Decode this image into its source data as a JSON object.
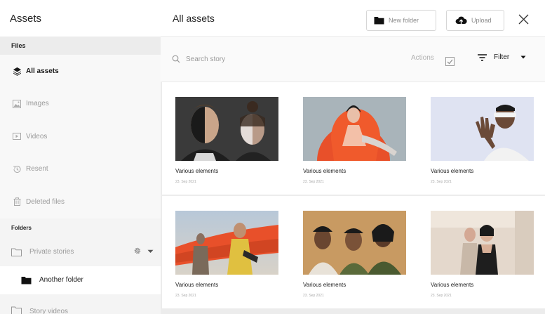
{
  "sidebar": {
    "title": "Assets",
    "files_section": "Files",
    "items": [
      {
        "label": "All assets",
        "icon": "layers-icon",
        "active": true
      },
      {
        "label": "Images",
        "icon": "image-icon",
        "active": false
      },
      {
        "label": "Videos",
        "icon": "video-icon",
        "active": false
      },
      {
        "label": "Resent",
        "icon": "history-icon",
        "active": false
      },
      {
        "label": "Deleted files",
        "icon": "trash-icon",
        "active": false
      }
    ],
    "folders_section": "Folders",
    "folders": [
      {
        "label": "Private stories",
        "icon": "folder-outline-icon"
      },
      {
        "label": "Another folder",
        "icon": "folder-filled-icon"
      },
      {
        "label": "Story videos",
        "icon": "folder-outline-icon"
      }
    ]
  },
  "main": {
    "title": "All assets",
    "new_folder_label": "New folder",
    "upload_label": "Upload",
    "search_placeholder": "Search story",
    "actions_label": "Actions",
    "filter_label": "Filter"
  },
  "assets": [
    {
      "name": "Various elements",
      "date": "23. Sep 2021"
    },
    {
      "name": "Various elements",
      "date": "23. Sep 2021"
    },
    {
      "name": "Various elements",
      "date": "23. Sep 2021"
    },
    {
      "name": "Various elements",
      "date": "23. Sep 2021"
    },
    {
      "name": "Various elements",
      "date": "23. Sep 2021"
    },
    {
      "name": "Various elements",
      "date": "23. Sep 2021"
    }
  ],
  "colors": {
    "sidebar_bg": "#f4f4f4",
    "border": "#d6d6d6",
    "accent_orange": "#e8502a"
  }
}
